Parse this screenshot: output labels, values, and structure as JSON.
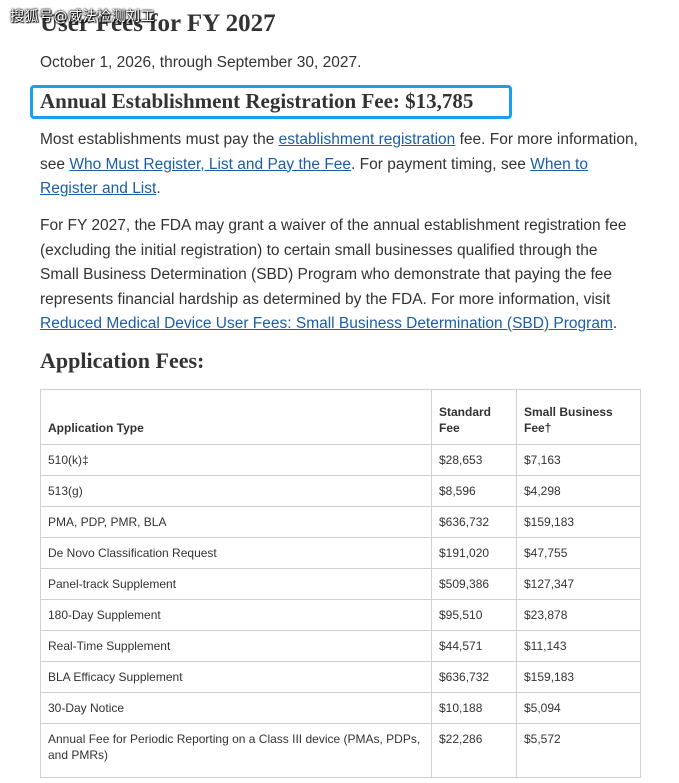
{
  "watermark": "搜狐号@威法检测刘工",
  "page": {
    "title": "User Fees for FY 2027",
    "date_range": "October 1, 2026, through September 30, 2027."
  },
  "registration": {
    "heading": "Annual Establishment Registration Fee: $13,785",
    "p1": {
      "t1": "Most establishments must pay the ",
      "link1": "establishment registration",
      "t2": " fee. For more information, see ",
      "link2": "Who Must Register, List and Pay the Fee",
      "t3": ". For payment timing, see ",
      "link3": "When to Register and List",
      "t4": "."
    },
    "p2": {
      "t1": "For FY 2027, the FDA may grant a waiver of the annual establishment registration fee (excluding the initial registration) to certain small businesses qualified through the Small Business Determination (SBD) Program who demonstrate that paying the fee represents financial hardship as determined by the FDA. For more information, visit ",
      "link1": "Reduced Medical Device User Fees: Small Business Determination (SBD) Program",
      "t2": "."
    }
  },
  "application_fees": {
    "heading": "Application Fees:",
    "headers": [
      "Application Type",
      "Standard Fee",
      "Small Business Fee†"
    ],
    "rows": [
      [
        "510(k)‡",
        "$28,653",
        "$7,163"
      ],
      [
        "513(g)",
        "$8,596",
        "$4,298"
      ],
      [
        "PMA, PDP, PMR, BLA",
        "$636,732",
        "$159,183"
      ],
      [
        "De Novo Classification Request",
        "$191,020",
        "$47,755"
      ],
      [
        "Panel-track Supplement",
        "$509,386",
        "$127,347"
      ],
      [
        "180-Day Supplement",
        "$95,510",
        "$23,878"
      ],
      [
        "Real-Time Supplement",
        "$44,571",
        "$11,143"
      ],
      [
        "BLA Efficacy Supplement",
        "$636,732",
        "$159,183"
      ],
      [
        "30-Day Notice",
        "$10,188",
        "$5,094"
      ],
      [
        "Annual Fee for Periodic Reporting on a Class III device (PMAs, PDPs, and PMRs)",
        "$22,286",
        "$5,572"
      ]
    ]
  }
}
